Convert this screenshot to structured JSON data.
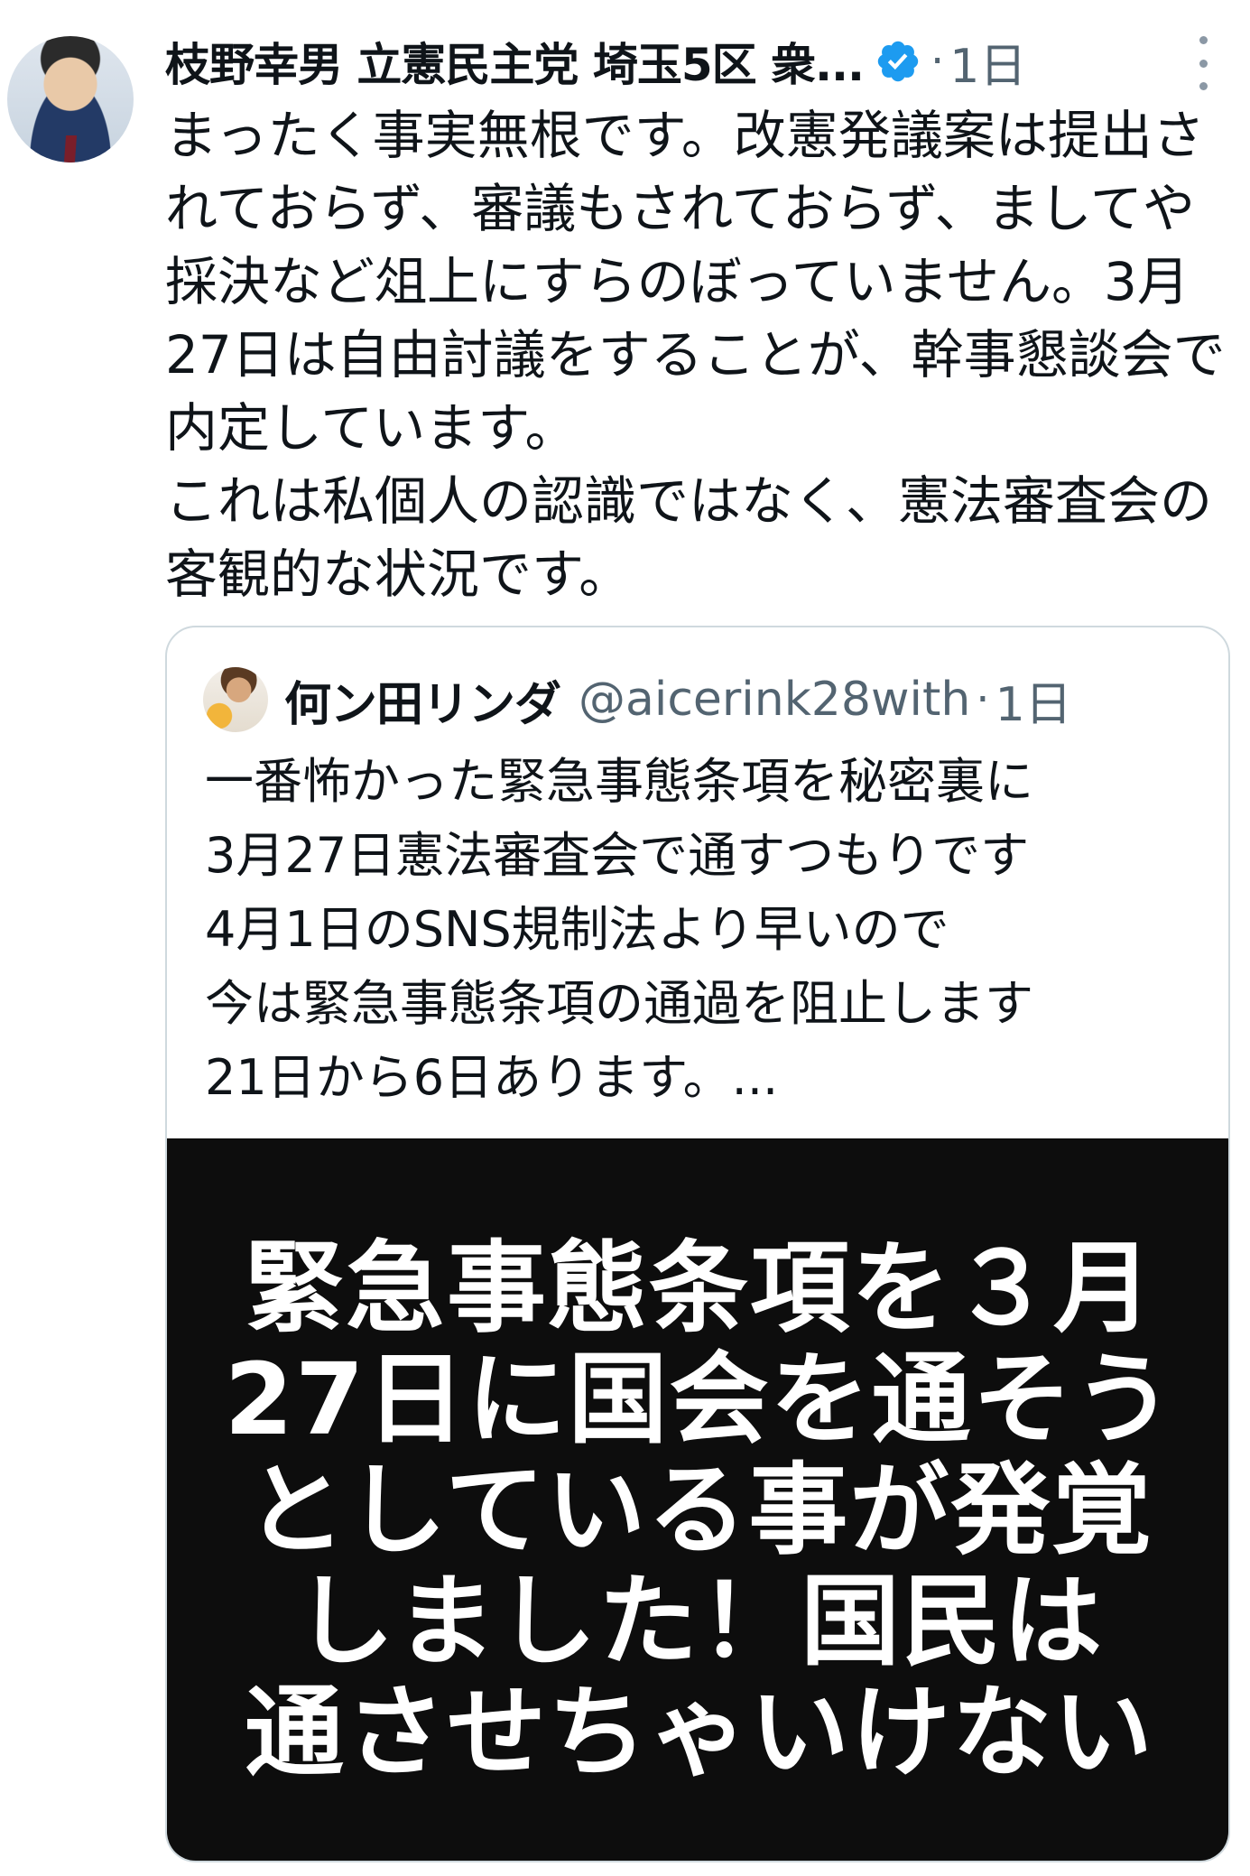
{
  "tweet": {
    "author_name": "枝野幸男 立憲民主党 埼玉5区 衆...",
    "separator": "·",
    "time": "1日",
    "verified_icon": "verified-badge-icon",
    "verified_color": "#1d9bf0",
    "body_lines": [
      "まったく事実無根です。改憲発議案は提出さ",
      "れておらず、審議もされておらず、ましてや",
      "採決など俎上にすらのぼっていません。3月",
      "27日は自由討議をすることが、幹事懇談会で",
      "内定しています。",
      "これは私個人の認識ではなく、憲法審査会の",
      "客観的な状況です。"
    ]
  },
  "quote": {
    "author_name": "何ン田リンダ",
    "handle": "@aicerink28with",
    "separator": "·",
    "time": "1日",
    "body_lines": [
      "一番怖かった緊急事態条項を秘密裏に",
      "3月27日憲法審査会で通すつもりです",
      "4月1日のSNS規制法より早いので",
      "今は緊急事態条項の通過を阻止します",
      "21日から6日あります。..."
    ],
    "image_text_lines": [
      "緊急事態条項を３月",
      "27日に国会を通そう",
      "としている事が発覚",
      "しました！国民は",
      "通させちゃいけない"
    ]
  }
}
